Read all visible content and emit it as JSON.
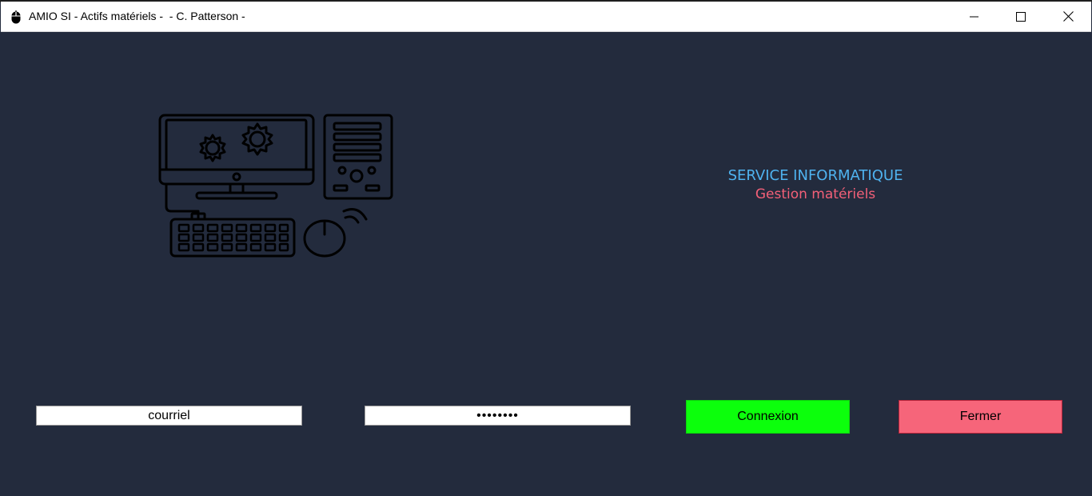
{
  "window": {
    "title": "AMIO SI - Actifs matériels -  - C. Patterson -",
    "app_icon": "mouse-icon",
    "controls": {
      "minimize_icon": "minimize-icon",
      "maximize_icon": "maximize-icon",
      "close_icon": "close-icon"
    }
  },
  "illustration": {
    "icon": "computer-settings-icon"
  },
  "heading": {
    "title": "SERVICE INFORMATIQUE",
    "subtitle": "Gestion matériels"
  },
  "login": {
    "email_placeholder": "courriel",
    "password_value": "********",
    "connect_label": "Connexion",
    "close_label": "Fermer"
  },
  "colors": {
    "background": "#232b3d",
    "heading_title": "#4fb3f0",
    "heading_subtitle": "#f36078",
    "connect_button": "#0cff0c",
    "close_button": "#f6657a"
  }
}
